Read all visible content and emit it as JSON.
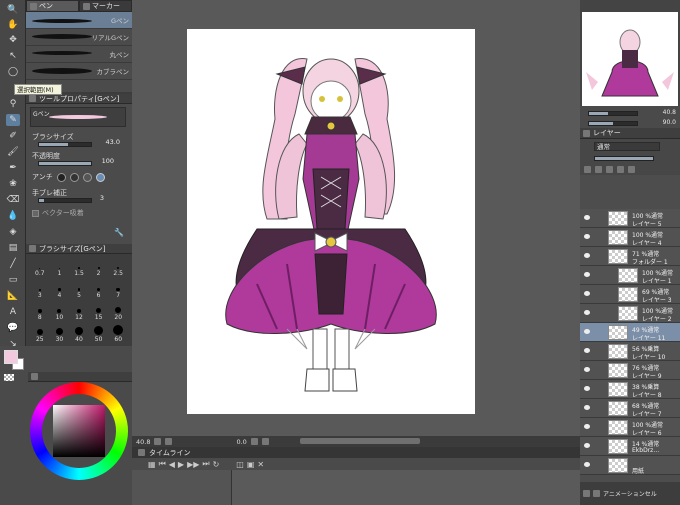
{
  "subtool": {
    "tab_pen": "ペン",
    "tab_marker": "マーカー",
    "brushes": [
      {
        "label": "Gペン"
      },
      {
        "label": "リアルGペン"
      },
      {
        "label": "丸ペン"
      },
      {
        "label": "カブラペン"
      }
    ]
  },
  "tooltip": "選択範囲(M)",
  "toolprop": {
    "header": "ツールプロパティ[Gペン]",
    "brush_name": "Gペン",
    "brush_size_label": "ブラシサイズ",
    "brush_size_value": "43.0",
    "opacity_label": "不透明度",
    "opacity_value": "100",
    "antialias_label": "アンチ",
    "stabilization_label": "手ブレ補正",
    "stabilization_value": "3",
    "vector_label": "ベクター吸着"
  },
  "brushsize": {
    "header": "ブラシサイズ[Gペン]",
    "sizes": [
      "0.7",
      "1",
      "1.5",
      "2",
      "2.5",
      "3",
      "4",
      "5",
      "6",
      "7",
      "8",
      "10",
      "12",
      "15",
      "20",
      "25",
      "30",
      "40",
      "50",
      "60",
      "70",
      "80",
      "100",
      "120"
    ]
  },
  "canvas_status": {
    "zoom": "40.8",
    "angle": "0.0"
  },
  "timeline": {
    "title": "タイムライン"
  },
  "navigator": {
    "zoom": "40.8",
    "rotation": "90.0"
  },
  "layers": {
    "tab": "レイヤー",
    "blend_mode": "通常",
    "items": [
      {
        "l1": "100 %通常",
        "l2": "レイヤー 5"
      },
      {
        "l1": "100 %通常",
        "l2": "レイヤー 4"
      },
      {
        "l1": "71 %通常",
        "l2": "フォルダー 1"
      },
      {
        "l1": "100 %通常",
        "l2": "レイヤー 1"
      },
      {
        "l1": "69 %通常",
        "l2": "レイヤー 3"
      },
      {
        "l1": "100 %通常",
        "l2": "レイヤー 2"
      },
      {
        "l1": "49 %通常",
        "l2": "レイヤー 11"
      },
      {
        "l1": "56 %乗算",
        "l2": "レイヤー 10"
      },
      {
        "l1": "76 %通常",
        "l2": "レイヤー 9"
      },
      {
        "l1": "38 %乗算",
        "l2": "レイヤー 8"
      },
      {
        "l1": "68 %通常",
        "l2": "レイヤー 7"
      },
      {
        "l1": "100 %通常",
        "l2": "レイヤー 6"
      },
      {
        "l1": "14 %通常",
        "l2": "EkbDrz…"
      },
      {
        "l1": "",
        "l2": "用紙"
      }
    ],
    "footer": "アニメーションセル"
  },
  "colors": {
    "main": "#f2c9df",
    "accent": "#5f7f9f",
    "dress": "#a0368f"
  }
}
